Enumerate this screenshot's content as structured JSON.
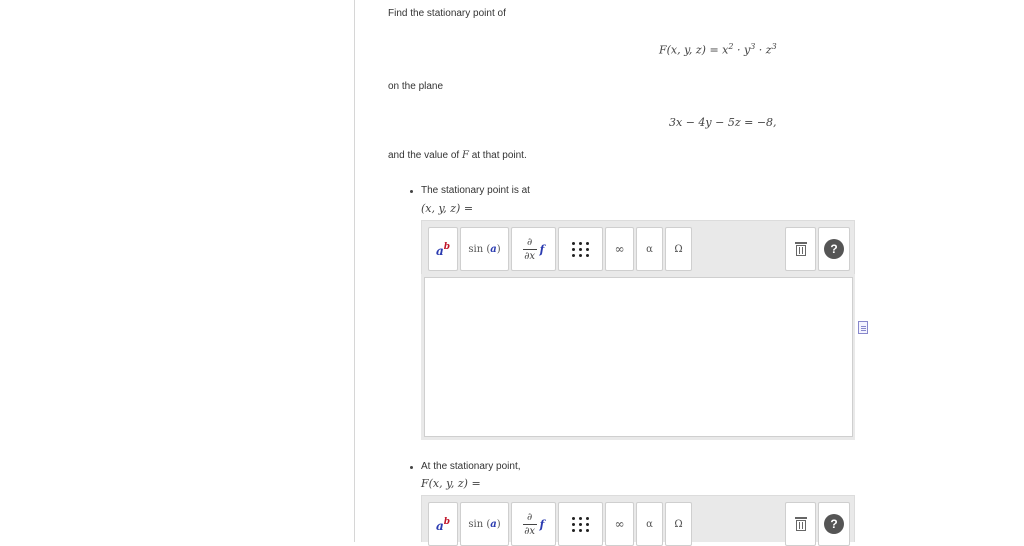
{
  "question": {
    "line1": "Find the stationary point of",
    "equation1": "F(x, y, z) = x² · y³ · z³",
    "line2": "on the plane",
    "equation2": "3x − 4y − 5z = −8,",
    "line3_prefix": "and the value of",
    "line3_var": "F",
    "line3_suffix": "at that point."
  },
  "parts": [
    {
      "label": "The stationary point is at",
      "expr": "(x, y, z) ="
    },
    {
      "label": "At the stationary point,",
      "expr": "F(x, y, z) ="
    }
  ],
  "toolbar": {
    "exponent_base": "a",
    "exponent_sup": "b",
    "sin_label": "sin",
    "sin_arg": "a",
    "deriv_num": "∂",
    "deriv_den": "∂x",
    "deriv_f": "f",
    "infinity": "∞",
    "alpha": "α",
    "omega": "Ω",
    "help": "?"
  },
  "icons": [
    "exponent-icon",
    "sin-icon",
    "derivative-icon",
    "matrix-icon",
    "infinity-icon",
    "alpha-icon",
    "omega-icon",
    "trash-icon",
    "help-icon",
    "document-icon"
  ]
}
